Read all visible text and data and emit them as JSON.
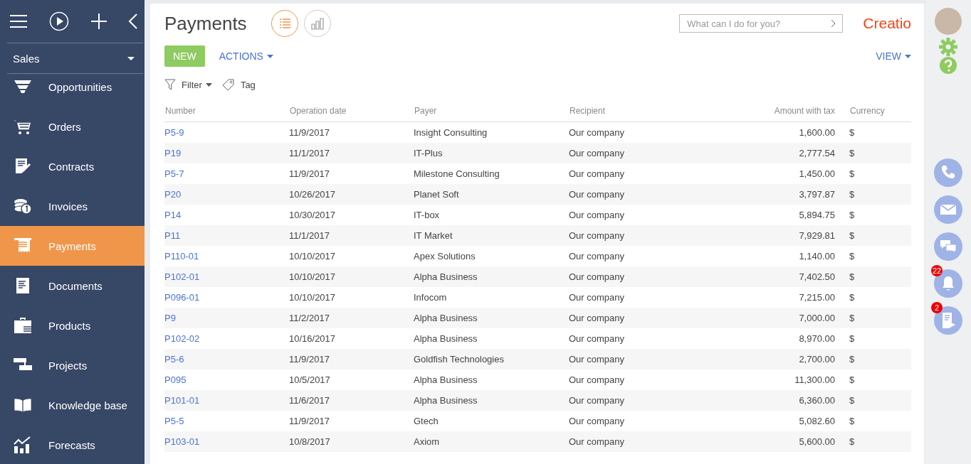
{
  "sidebar": {
    "section": "Sales",
    "items": [
      {
        "label": "Opportunities",
        "selected": false
      },
      {
        "label": "Orders",
        "selected": false
      },
      {
        "label": "Contracts",
        "selected": false
      },
      {
        "label": "Invoices",
        "selected": false
      },
      {
        "label": "Payments",
        "selected": true
      },
      {
        "label": "Documents",
        "selected": false
      },
      {
        "label": "Products",
        "selected": false
      },
      {
        "label": "Projects",
        "selected": false
      },
      {
        "label": "Knowledge base",
        "selected": false
      },
      {
        "label": "Forecasts",
        "selected": false
      }
    ]
  },
  "page": {
    "title": "Payments",
    "view_toggle": [
      {
        "kind": "list",
        "selected": true
      },
      {
        "kind": "chart",
        "selected": false
      }
    ],
    "search": {
      "placeholder": "What can I do for you?"
    },
    "logo": "Creatio",
    "toolbar": {
      "new": "NEW",
      "actions": "ACTIONS",
      "view": "VIEW"
    },
    "filters": {
      "filter": "Filter",
      "tag": "Tag"
    }
  },
  "table": {
    "columns": [
      "Number",
      "Operation date",
      "Payer",
      "Recipient",
      "Amount with tax",
      "Currency"
    ],
    "rows": [
      [
        "P5-9",
        "11/9/2017",
        "Insight Consulting",
        "Our company",
        "1,600.00",
        "$"
      ],
      [
        "P19",
        "11/1/2017",
        "IT-Plus",
        "Our company",
        "2,777.54",
        "$"
      ],
      [
        "P5-7",
        "11/9/2017",
        "Milestone Consulting",
        "Our company",
        "1,450.00",
        "$"
      ],
      [
        "P20",
        "10/26/2017",
        "Planet Soft",
        "Our company",
        "3,797.87",
        "$"
      ],
      [
        "P14",
        "10/30/2017",
        "IT-box",
        "Our company",
        "5,894.75",
        "$"
      ],
      [
        "P11",
        "11/1/2017",
        "IT Market",
        "Our company",
        "7,929.81",
        "$"
      ],
      [
        "P110-01",
        "10/10/2017",
        "Apex Solutions",
        "Our company",
        "1,140.00",
        "$"
      ],
      [
        "P102-01",
        "10/10/2017",
        "Alpha Business",
        "Our company",
        "7,402.50",
        "$"
      ],
      [
        "P096-01",
        "10/10/2017",
        "Infocom",
        "Our company",
        "7,215.00",
        "$"
      ],
      [
        "P9",
        "11/2/2017",
        "Alpha Business",
        "Our company",
        "7,000.00",
        "$"
      ],
      [
        "P102-02",
        "10/16/2017",
        "Alpha Business",
        "Our company",
        "8,970.00",
        "$"
      ],
      [
        "P5-6",
        "11/9/2017",
        "Goldfish Technologies",
        "Our company",
        "2,700.00",
        "$"
      ],
      [
        "P095",
        "10/5/2017",
        "Alpha Business",
        "Our company",
        "11,300.00",
        "$"
      ],
      [
        "P101-01",
        "11/6/2017",
        "Alpha Business",
        "Our company",
        "6,360.00",
        "$"
      ],
      [
        "P5-5",
        "11/9/2017",
        "Gtech",
        "Our company",
        "5,082.60",
        "$"
      ],
      [
        "P103-01",
        "10/8/2017",
        "Axiom",
        "Our company",
        "5,600.00",
        "$"
      ]
    ]
  },
  "rail": {
    "buttons": [
      {
        "kind": "phone"
      },
      {
        "kind": "email"
      },
      {
        "kind": "chat"
      },
      {
        "kind": "notifications",
        "badge": "22"
      },
      {
        "kind": "feed",
        "badge": "2"
      }
    ]
  }
}
